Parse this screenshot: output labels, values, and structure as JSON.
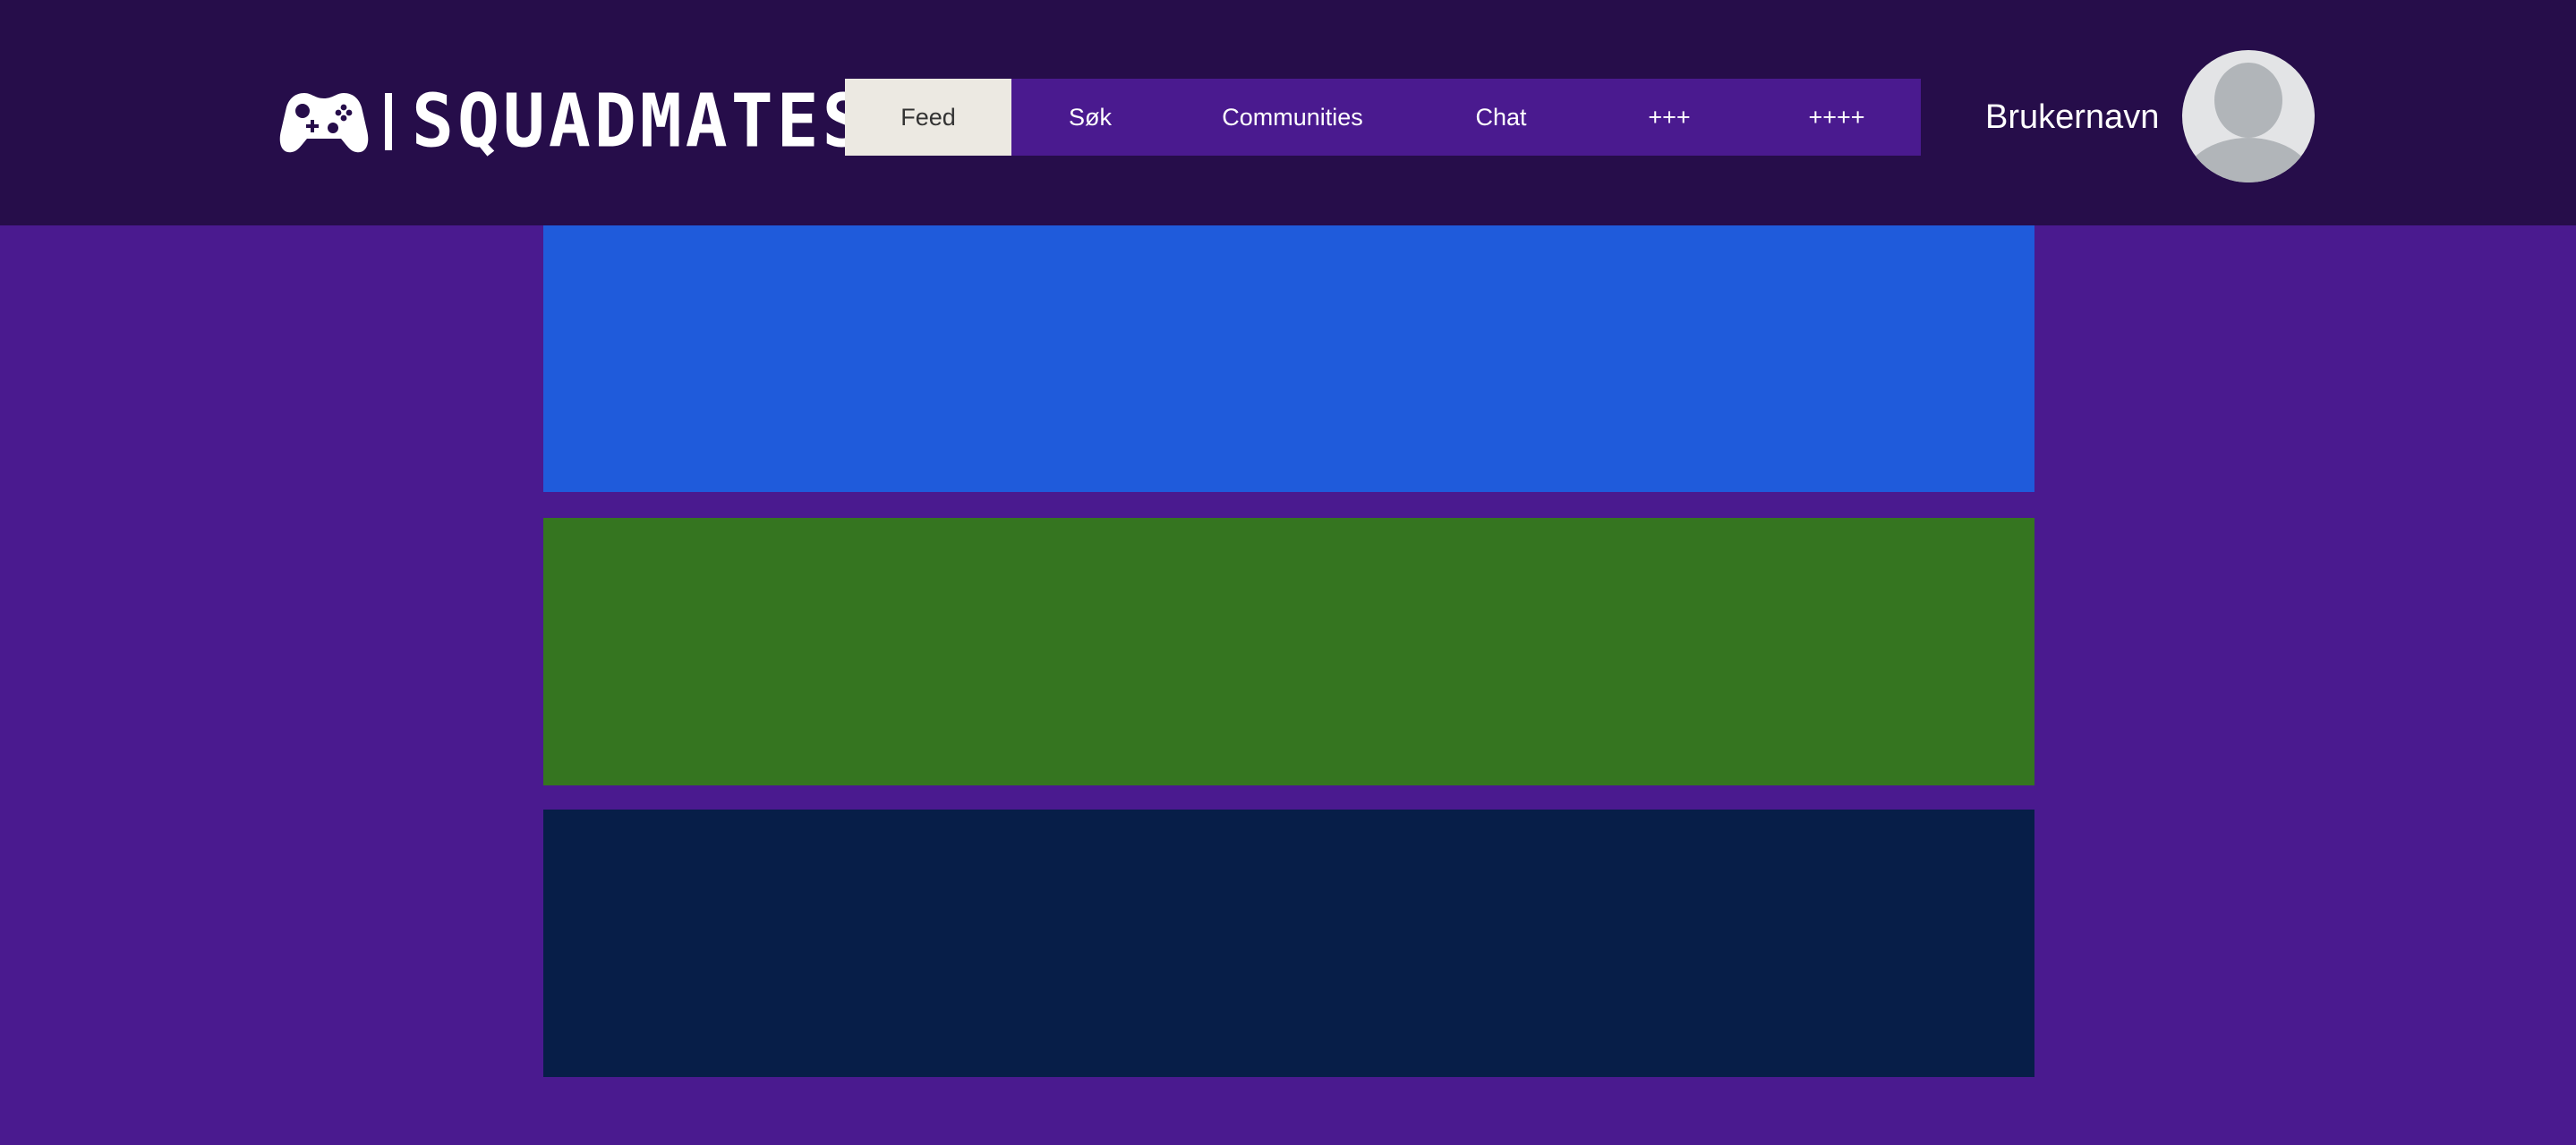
{
  "app": {
    "name": "SQUADMATES",
    "separator": "|"
  },
  "nav": {
    "items": [
      {
        "label": "Feed",
        "active": true
      },
      {
        "label": "Søk",
        "active": false
      },
      {
        "label": "Communities",
        "active": false
      },
      {
        "label": "Chat",
        "active": false
      },
      {
        "label": "+++",
        "active": false
      },
      {
        "label": "++++",
        "active": false
      }
    ]
  },
  "user": {
    "name": "Brukernavn",
    "avatar_icon": "user-placeholder-icon"
  },
  "icons": {
    "logo": "gamepad-icon"
  },
  "feed": {
    "panels": [
      {
        "color": "#1f5bdb"
      },
      {
        "color": "#357520"
      },
      {
        "color": "#071e48"
      }
    ]
  },
  "colors": {
    "page_background": "#4a1a8f",
    "header_background": "#260d4a",
    "nav_background": "#4a1a8f",
    "nav_active_background": "#ece9e2"
  }
}
